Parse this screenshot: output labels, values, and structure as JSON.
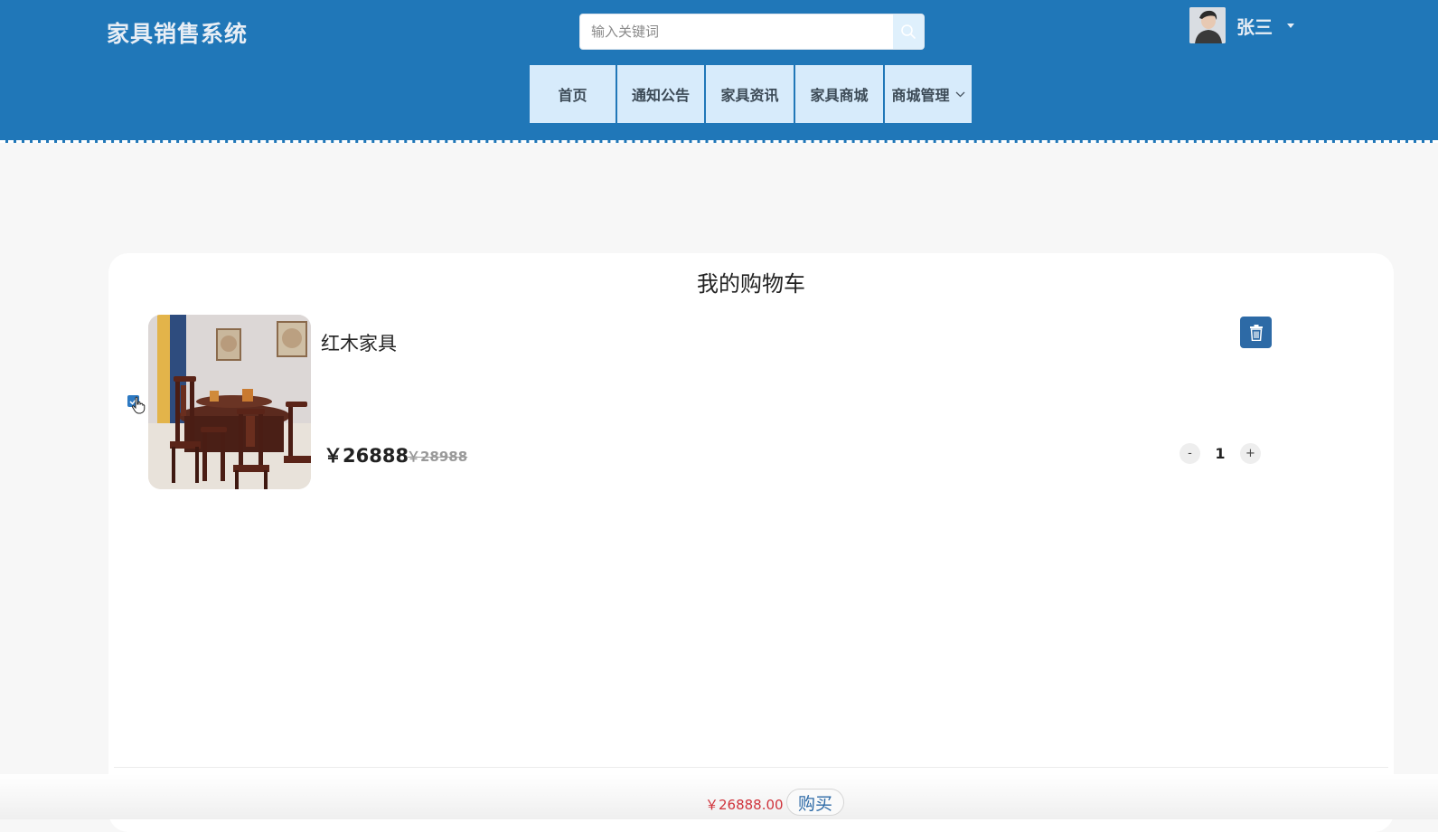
{
  "header": {
    "brand": "家具销售系统",
    "search": {
      "placeholder": "输入关键词"
    },
    "user": {
      "name": "张三"
    }
  },
  "nav": {
    "items": [
      {
        "label": "首页"
      },
      {
        "label": "通知公告"
      },
      {
        "label": "家具资讯"
      },
      {
        "label": "家具商城"
      },
      {
        "label": "商城管理"
      }
    ]
  },
  "cart": {
    "title": "我的购物车",
    "items": [
      {
        "name": "红木家具",
        "price": "￥26888",
        "old_price": "￥28988",
        "quantity": "1",
        "selected": true,
        "decrease_label": "-",
        "increase_label": "+"
      }
    ],
    "total": "￥26888.00",
    "buy_label": "购买"
  },
  "colors": {
    "header_bg": "#2077b8",
    "nav_item_bg": "#d7ebfb",
    "delete_button": "#2d6aa6",
    "total_price": "#d0343c"
  },
  "icons": {
    "search": "search-icon",
    "trash": "trash-icon",
    "check": "check-icon",
    "chevron": "chevron-down-icon"
  }
}
